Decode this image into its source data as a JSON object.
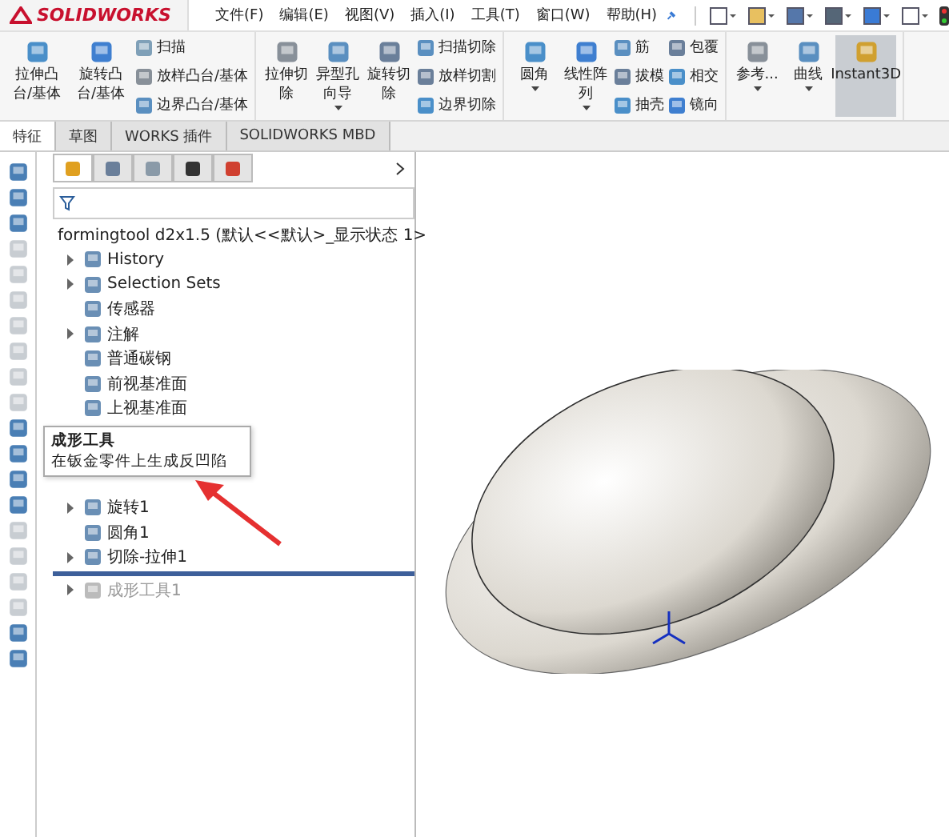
{
  "app": {
    "logo": "SOLIDWORKS"
  },
  "menu": [
    {
      "label": "文件(F)"
    },
    {
      "label": "编辑(E)"
    },
    {
      "label": "视图(V)"
    },
    {
      "label": "插入(I)"
    },
    {
      "label": "工具(T)"
    },
    {
      "label": "窗口(W)"
    },
    {
      "label": "帮助(H)"
    }
  ],
  "ribbon": [
    {
      "items": [
        {
          "kind": "large",
          "label": "拉伸凸台/基体",
          "dropdown": false,
          "selected": false
        },
        {
          "kind": "large",
          "label": "旋转凸台/基体",
          "dropdown": false,
          "selected": false
        },
        {
          "kind": "stack",
          "entries": [
            {
              "label": "扫描"
            },
            {
              "label": "放样凸台/基体"
            },
            {
              "label": "边界凸台/基体"
            }
          ]
        }
      ]
    },
    {
      "items": [
        {
          "kind": "large",
          "label": "拉伸切除",
          "dropdown": false,
          "selected": false
        },
        {
          "kind": "large",
          "label": "异型孔向导",
          "dropdown": true,
          "selected": false
        },
        {
          "kind": "large",
          "label": "旋转切除",
          "dropdown": false,
          "selected": false
        },
        {
          "kind": "stack",
          "entries": [
            {
              "label": "扫描切除"
            },
            {
              "label": "放样切割"
            },
            {
              "label": "边界切除"
            }
          ]
        }
      ]
    },
    {
      "items": [
        {
          "kind": "large",
          "label": "圆角",
          "dropdown": true,
          "selected": false
        },
        {
          "kind": "large",
          "label": "线性阵列",
          "dropdown": true,
          "selected": false
        },
        {
          "kind": "stack",
          "entries": [
            {
              "label": "筋"
            },
            {
              "label": "拔模"
            },
            {
              "label": "抽壳"
            }
          ]
        },
        {
          "kind": "stack",
          "entries": [
            {
              "label": "包覆"
            },
            {
              "label": "相交"
            },
            {
              "label": "镜向"
            }
          ]
        }
      ]
    },
    {
      "items": [
        {
          "kind": "large",
          "label": "参考...",
          "dropdown": true,
          "selected": false
        },
        {
          "kind": "large",
          "label": "曲线",
          "dropdown": true,
          "selected": false
        },
        {
          "kind": "large",
          "label": "Instant3D",
          "dropdown": false,
          "selected": true
        }
      ]
    }
  ],
  "tabs": [
    {
      "label": "特征",
      "selected": true
    },
    {
      "label": "草图",
      "selected": false
    },
    {
      "label": "WORKS 插件",
      "selected": false
    },
    {
      "label": "SOLIDWORKS MBD",
      "selected": false
    }
  ],
  "left_toolbar": [
    {
      "enabled": true
    },
    {
      "enabled": true
    },
    {
      "enabled": true
    },
    {
      "enabled": false
    },
    {
      "enabled": false
    },
    {
      "enabled": false
    },
    {
      "enabled": false
    },
    {
      "enabled": false
    },
    {
      "enabled": false
    },
    {
      "enabled": false
    },
    {
      "enabled": true
    },
    {
      "enabled": true
    },
    {
      "enabled": true
    },
    {
      "enabled": true
    },
    {
      "enabled": false
    },
    {
      "enabled": false
    },
    {
      "enabled": false
    },
    {
      "enabled": false
    },
    {
      "enabled": true
    },
    {
      "enabled": true
    }
  ],
  "panel_tabs": [
    {
      "selected": true
    },
    {
      "selected": false
    },
    {
      "selected": false
    },
    {
      "selected": false
    },
    {
      "selected": false
    }
  ],
  "tree": {
    "root": "formingtool d2x1.5  (默认<<默认>_显示状态 1>",
    "items": [
      {
        "label": "History",
        "expandable": true,
        "suppressed": false
      },
      {
        "label": "Selection Sets",
        "expandable": true,
        "suppressed": false
      },
      {
        "label": "传感器",
        "expandable": false,
        "suppressed": false
      },
      {
        "label": "注解",
        "expandable": true,
        "suppressed": false
      },
      {
        "label": "普通碳钢",
        "expandable": false,
        "suppressed": false
      },
      {
        "label": "前视基准面",
        "expandable": false,
        "suppressed": false
      },
      {
        "label": "上视基准面",
        "expandable": false,
        "suppressed": false
      },
      {
        "kind": "hidden"
      },
      {
        "kind": "hidden"
      },
      {
        "kind": "hidden"
      },
      {
        "label": "旋转1",
        "expandable": true,
        "suppressed": false
      },
      {
        "label": "圆角1",
        "expandable": false,
        "suppressed": false
      },
      {
        "label": "切除-拉伸1",
        "expandable": true,
        "suppressed": false
      },
      {
        "kind": "rollback"
      },
      {
        "label": "成形工具1",
        "expandable": true,
        "suppressed": true
      }
    ]
  },
  "tooltip": {
    "title": "成形工具",
    "text": "在钣金零件上生成反凹陷"
  }
}
